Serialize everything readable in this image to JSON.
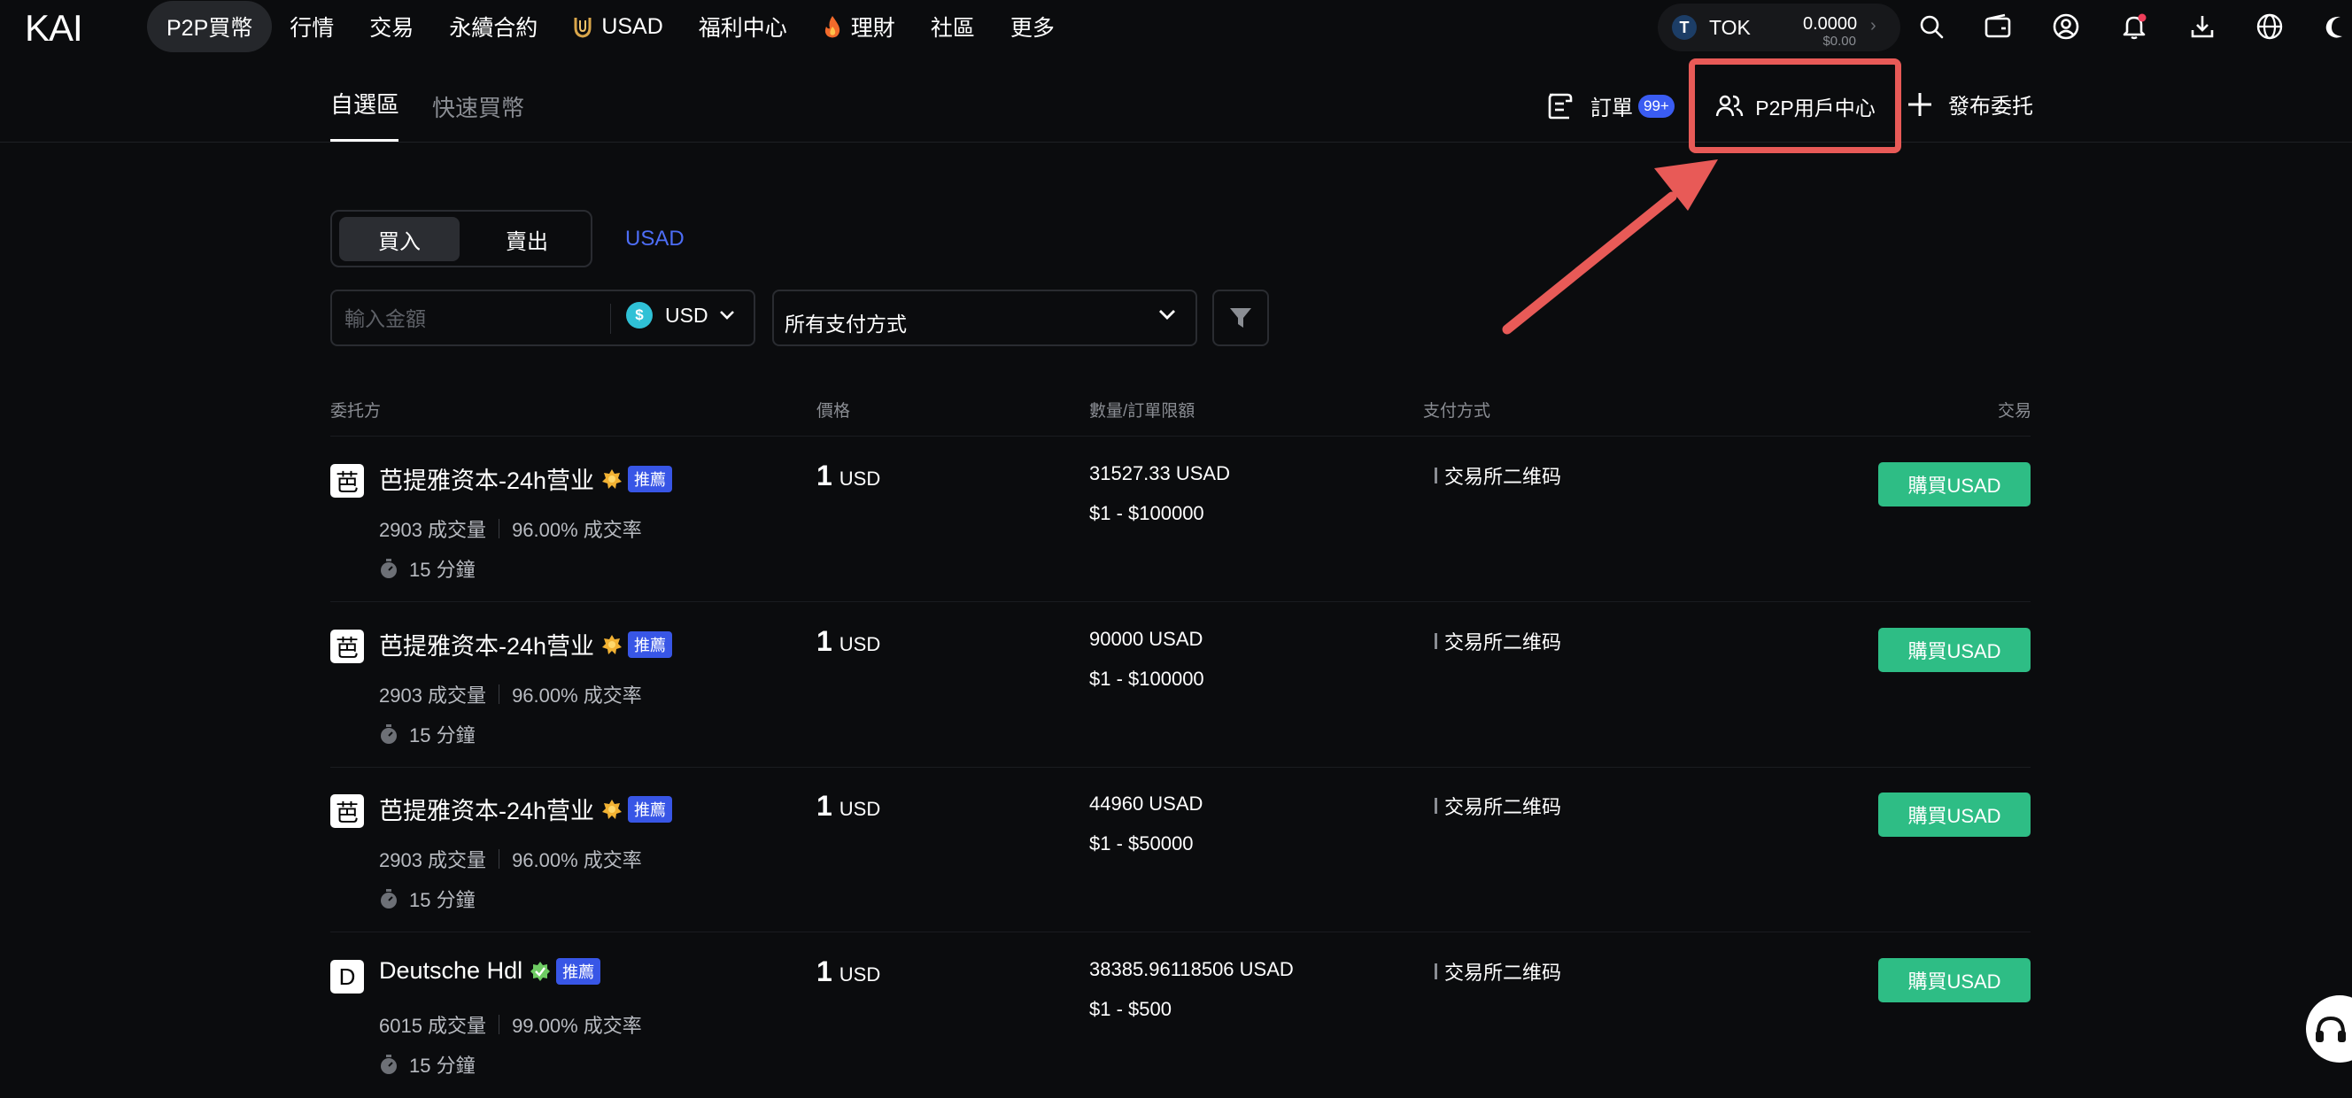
{
  "brand": {
    "logo_text": "KAI"
  },
  "nav": {
    "items": [
      {
        "label": "P2P買幣",
        "icon": ""
      },
      {
        "label": "行情",
        "icon": ""
      },
      {
        "label": "交易",
        "icon": ""
      },
      {
        "label": "永續合約",
        "icon": ""
      },
      {
        "label": "USAD",
        "icon": "usad-coin-icon"
      },
      {
        "label": "福利中心",
        "icon": ""
      },
      {
        "label": "理財",
        "icon": "fire-icon"
      },
      {
        "label": "社區",
        "icon": ""
      },
      {
        "label": "更多",
        "icon": ""
      }
    ]
  },
  "wallet": {
    "token_letter": "T",
    "token": "TOK",
    "balance": "0.0000",
    "balance_usd": "$0.00",
    "chevron": "›"
  },
  "tabs": {
    "custom": "自選區",
    "quick": "快速買幣"
  },
  "actions": {
    "orders": "訂單",
    "orders_badge": "99+",
    "p2p_center": "P2P用戶中心",
    "publish": "發布委托"
  },
  "trade": {
    "buy": "買入",
    "sell": "賣出",
    "asset": "USAD"
  },
  "filters": {
    "amount_placeholder": "輸入金額",
    "currency_symbol": "$",
    "currency": "USD",
    "payment": "所有支付方式"
  },
  "table": {
    "headers": {
      "advertiser": "委托方",
      "price": "價格",
      "quantity": "數量/訂單限額",
      "payment": "支付方式",
      "trade": "交易"
    },
    "rows": [
      {
        "avatar": "芭",
        "name": "芭提雅资本-24h营业",
        "tag": "推薦",
        "trades": "2903 成交量",
        "rate": "96.00% 成交率",
        "time": "15 分鐘",
        "price": "1",
        "price_currency": "USD",
        "quantity": "31527.33 USAD",
        "limit": "$1  -  $100000",
        "payment": "交易所二维码",
        "button": "購買USAD"
      },
      {
        "avatar": "芭",
        "name": "芭提雅资本-24h营业",
        "tag": "推薦",
        "trades": "2903 成交量",
        "rate": "96.00% 成交率",
        "time": "15 分鐘",
        "price": "1",
        "price_currency": "USD",
        "quantity": "90000 USAD",
        "limit": "$1  -  $100000",
        "payment": "交易所二维码",
        "button": "購買USAD"
      },
      {
        "avatar": "芭",
        "name": "芭提雅资本-24h营业",
        "tag": "推薦",
        "trades": "2903 成交量",
        "rate": "96.00% 成交率",
        "time": "15 分鐘",
        "price": "1",
        "price_currency": "USD",
        "quantity": "44960 USAD",
        "limit": "$1  -  $50000",
        "payment": "交易所二维码",
        "button": "購買USAD"
      },
      {
        "avatar": "D",
        "name": "Deutsche Hdl",
        "tag": "推薦",
        "trades": "6015 成交量",
        "rate": "99.00% 成交率",
        "time": "15 分鐘",
        "price": "1",
        "price_currency": "USD",
        "quantity": "38385.96118506 USAD",
        "limit": "$1  -  $500",
        "payment": "交易所二维码",
        "button": "購買USAD"
      }
    ]
  },
  "colors": {
    "background": "#0b0c0e",
    "accent_blue": "#4d6df5",
    "buy_green": "#2ebd85",
    "highlight_red": "#e85a57"
  }
}
